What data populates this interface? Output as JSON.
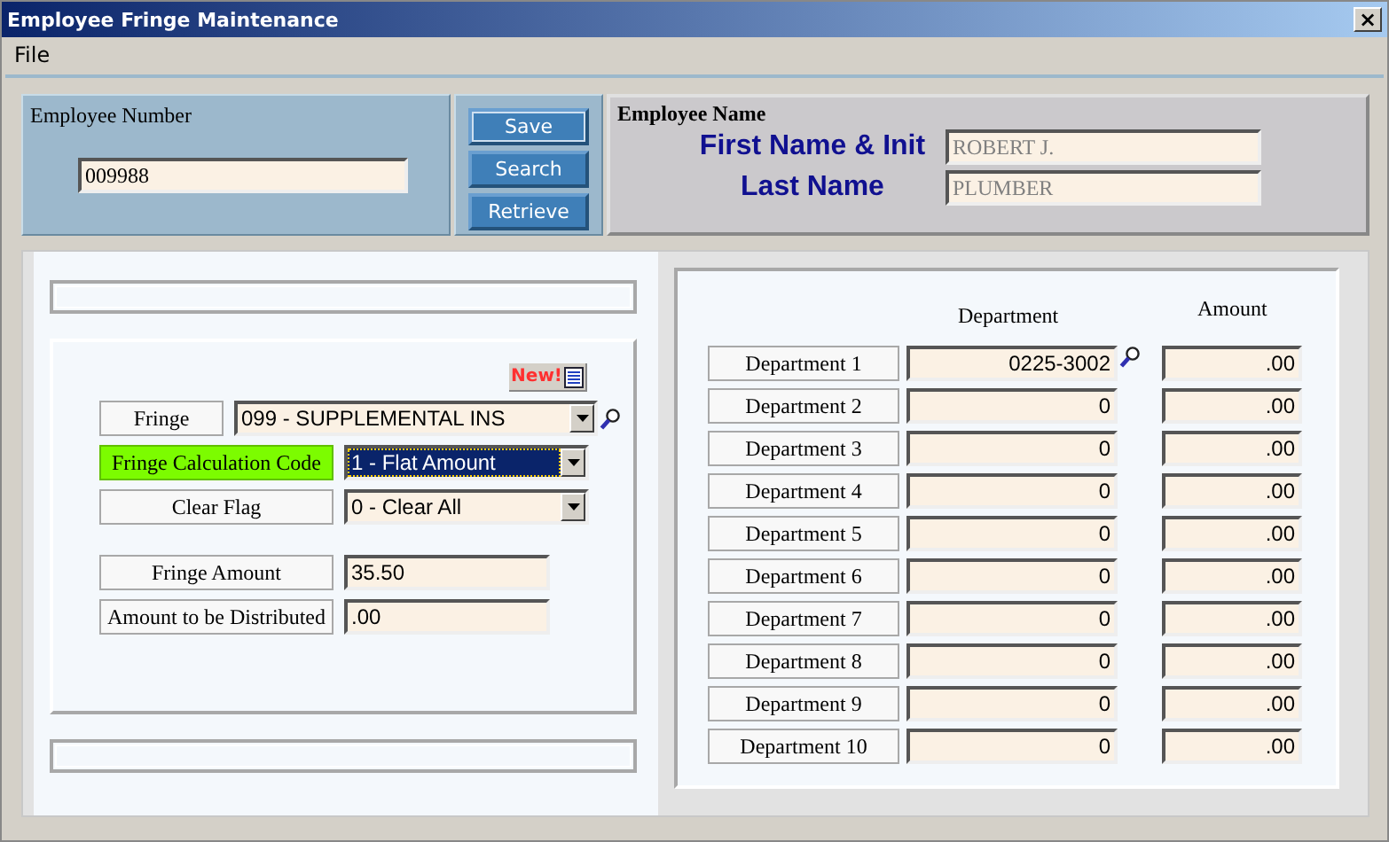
{
  "window": {
    "title": "Employee Fringe Maintenance",
    "close": "×"
  },
  "menu": [
    "File"
  ],
  "employee_number": {
    "label": "Employee Number",
    "value": "009988"
  },
  "buttons": [
    "Save",
    "Search",
    "Retrieve"
  ],
  "employee_name": {
    "heading": "Employee Name",
    "first_label": "First Name & Init",
    "first_value": "ROBERT J.",
    "last_label": "Last Name",
    "last_value": "PLUMBER"
  },
  "new_badge": "New!",
  "fringe_fields": [
    {
      "kind": "select",
      "label": "Fringe",
      "value": "099 - SUPPLEMENTAL INS",
      "highlighted": false,
      "focused": false,
      "lookup": true
    },
    {
      "kind": "select",
      "label": "Fringe Calculation Code",
      "value": "1 - Flat Amount",
      "highlighted": true,
      "focused": true,
      "lookup": false
    },
    {
      "kind": "select",
      "label": "Clear Flag",
      "value": "0 - Clear All",
      "highlighted": false,
      "focused": false,
      "lookup": false
    },
    {
      "kind": "input",
      "label": "Fringe Amount",
      "value": "35.50",
      "highlighted": false,
      "focused": false,
      "lookup": false
    },
    {
      "kind": "input",
      "label": "Amount to be Distributed",
      "value": ".00",
      "highlighted": false,
      "focused": false,
      "lookup": false
    }
  ],
  "distribution": {
    "columns": [
      "Department",
      "Amount"
    ],
    "rows": [
      {
        "label": "Department 1",
        "department": "0225-3002",
        "amount": ".00",
        "lookup": true
      },
      {
        "label": "Department 2",
        "department": "0",
        "amount": ".00",
        "lookup": false
      },
      {
        "label": "Department 3",
        "department": "0",
        "amount": ".00",
        "lookup": false
      },
      {
        "label": "Department 4",
        "department": "0",
        "amount": ".00",
        "lookup": false
      },
      {
        "label": "Department 5",
        "department": "0",
        "amount": ".00",
        "lookup": false
      },
      {
        "label": "Department 6",
        "department": "0",
        "amount": ".00",
        "lookup": false
      },
      {
        "label": "Department 7",
        "department": "0",
        "amount": ".00",
        "lookup": false
      },
      {
        "label": "Department 8",
        "department": "0",
        "amount": ".00",
        "lookup": false
      },
      {
        "label": "Department 9",
        "department": "0",
        "amount": ".00",
        "lookup": false
      },
      {
        "label": "Department 10",
        "department": "0",
        "amount": ".00",
        "lookup": false
      }
    ]
  }
}
